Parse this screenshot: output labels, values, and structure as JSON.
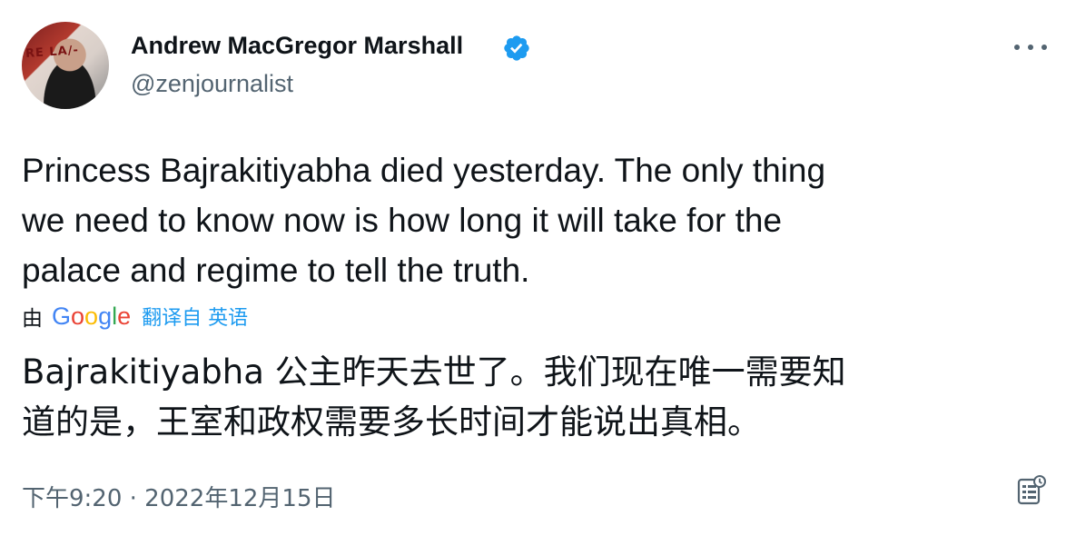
{
  "author": {
    "display_name": "Andrew MacGregor Marshall",
    "handle": "@zenjournalist",
    "verified": true,
    "avatar_icon": "avatar-photo"
  },
  "tweet": {
    "text": "Princess Bajrakitiyabha died yesterday. The only thing\nwe need to know now is how long it will take for the\npalace and regime to tell the truth.",
    "translation_by": "由",
    "translation_provider_letters": [
      "G",
      "o",
      "o",
      "g",
      "l",
      "e"
    ],
    "translated_from_label": "翻译自 英语",
    "translated_text": "Bajrakitiyabha 公主昨天去世了。我们现在唯一需要知\n道的是，王室和政权需要多长时间才能说出真相。",
    "timestamp": "下午9:20 · 2022年12月15日"
  },
  "colors": {
    "text": "#0f1419",
    "secondary": "#536471",
    "link": "#1d9bf0",
    "verified": "#1d9bf0"
  },
  "icons": {
    "more": "more-horizontal-icon",
    "verified": "verified-badge-icon",
    "info": "tweet-analytics-icon"
  }
}
